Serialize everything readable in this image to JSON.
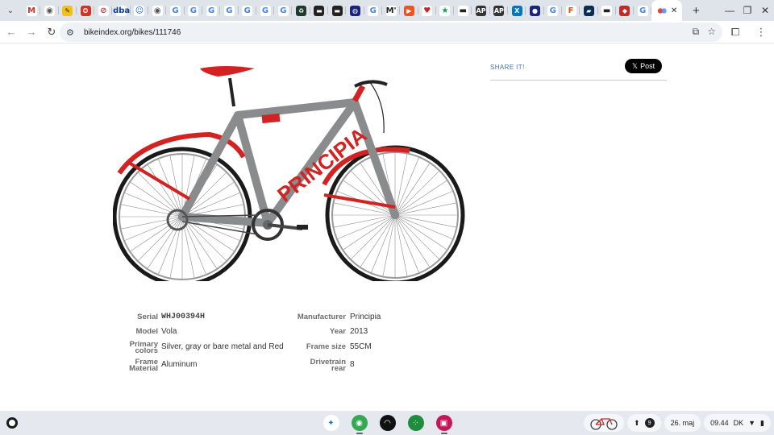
{
  "browser": {
    "tabs": [
      {
        "icon": "gmail-icon",
        "color": "#d93025",
        "glyph": "M",
        "bg": "#ffffff"
      },
      {
        "icon": "chrome-tab-icon",
        "color": "#555555",
        "glyph": "◉",
        "bg": "#ffffff"
      },
      {
        "icon": "yellow-app-icon",
        "color": "#222",
        "glyph": "✎",
        "bg": "#f4c20d"
      },
      {
        "icon": "red-circle-icon",
        "color": "#fff",
        "glyph": "✪",
        "bg": "#d93025"
      },
      {
        "icon": "block-icon",
        "color": "#d93025",
        "glyph": "⊘",
        "bg": "#ffffff"
      },
      {
        "icon": "dba-icon",
        "color": "#0b3d91",
        "glyph": "dba",
        "bg": "#ffffff"
      },
      {
        "icon": "blue-face-icon",
        "color": "#0b57d0",
        "glyph": "☺",
        "bg": "#ffffff"
      },
      {
        "icon": "globe-icon",
        "color": "#555",
        "glyph": "◉",
        "bg": "#ffffff"
      },
      {
        "icon": "google-icon",
        "color": "#4285f4",
        "glyph": "G",
        "bg": "#ffffff"
      },
      {
        "icon": "google-icon",
        "color": "#4285f4",
        "glyph": "G",
        "bg": "#ffffff"
      },
      {
        "icon": "google-icon",
        "color": "#4285f4",
        "glyph": "G",
        "bg": "#ffffff"
      },
      {
        "icon": "google-icon",
        "color": "#4285f4",
        "glyph": "G",
        "bg": "#ffffff"
      },
      {
        "icon": "google-icon",
        "color": "#4285f4",
        "glyph": "G",
        "bg": "#ffffff"
      },
      {
        "icon": "google-icon",
        "color": "#4285f4",
        "glyph": "G",
        "bg": "#ffffff"
      },
      {
        "icon": "google-icon",
        "color": "#4285f4",
        "glyph": "G",
        "bg": "#ffffff"
      },
      {
        "icon": "recycle-icon",
        "color": "#fff",
        "glyph": "♻",
        "bg": "#1e3a2a"
      },
      {
        "icon": "dark-square-icon",
        "color": "#fff",
        "glyph": "▬",
        "bg": "#222222"
      },
      {
        "icon": "dark-square-icon",
        "color": "#fff",
        "glyph": "▬",
        "bg": "#222222"
      },
      {
        "icon": "blue-globe-icon",
        "color": "#fff",
        "glyph": "◍",
        "bg": "#1a237e"
      },
      {
        "icon": "google-icon",
        "color": "#4285f4",
        "glyph": "G",
        "bg": "#ffffff"
      },
      {
        "icon": "medium-icon",
        "color": "#222",
        "glyph": "M'",
        "bg": "#ffffff"
      },
      {
        "icon": "orange-play-icon",
        "color": "#fff",
        "glyph": "▶",
        "bg": "#f4511e"
      },
      {
        "icon": "heart-icon",
        "color": "#c62828",
        "glyph": "♥",
        "bg": "#ffffff"
      },
      {
        "icon": "star-icon",
        "color": "#0f9d58",
        "glyph": "★",
        "bg": "#ffffff"
      },
      {
        "icon": "dash-icon",
        "color": "#222",
        "glyph": "▬",
        "bg": "#ffffff"
      },
      {
        "icon": "ap-icon",
        "color": "#fff",
        "glyph": "AP",
        "bg": "#333333"
      },
      {
        "icon": "ap-icon",
        "color": "#fff",
        "glyph": "AP",
        "bg": "#333333"
      },
      {
        "icon": "x-app-icon",
        "color": "#fff",
        "glyph": "X",
        "bg": "#0277bd"
      },
      {
        "icon": "pill-icon",
        "color": "#fff",
        "glyph": "●",
        "bg": "#1a237e"
      },
      {
        "icon": "google-icon",
        "color": "#4285f4",
        "glyph": "G",
        "bg": "#ffffff"
      },
      {
        "icon": "f-icon",
        "color": "#e65100",
        "glyph": "F",
        "bg": "#ffffff"
      },
      {
        "icon": "bag-icon",
        "color": "#fff",
        "glyph": "▰",
        "bg": "#0d2c54"
      },
      {
        "icon": "dash-icon",
        "color": "#222",
        "glyph": "▬",
        "bg": "#ffffff"
      },
      {
        "icon": "red-app-icon",
        "color": "#fff",
        "glyph": "◆",
        "bg": "#c62828"
      },
      {
        "icon": "google-icon",
        "color": "#4285f4",
        "glyph": "G",
        "bg": "#ffffff"
      }
    ],
    "active_tab": {
      "icon": "shield-icon",
      "close": "✕"
    },
    "new_tab": "+",
    "window_controls": {
      "minimize": "—",
      "restore": "❐",
      "close": "✕"
    },
    "url": "bikeindex.org/bikes/111746",
    "nav": {
      "back": "←",
      "forward": "→",
      "reload": "↻"
    }
  },
  "share": {
    "label": "SHARE IT!",
    "post_button": "Post",
    "post_icon": "𝕏"
  },
  "bike": {
    "brand_decal": "PRINCIPIA",
    "colors": {
      "frame": "#8a8b8d",
      "accent": "#d32222",
      "tire": "#1a1a1a"
    }
  },
  "details": [
    {
      "label": "Serial",
      "value": "WHJ00394H",
      "mono": true
    },
    {
      "label": "Manufacturer",
      "value": "Principia"
    },
    {
      "label": "Model",
      "value": "Vola"
    },
    {
      "label": "Year",
      "value": "2013"
    },
    {
      "label": "Primary colors",
      "label_lines": [
        "Primary",
        "colors"
      ],
      "value": "Silver, gray or bare metal and Red"
    },
    {
      "label": "Frame size",
      "value": "55CM"
    },
    {
      "label": "Frame Material",
      "label_lines": [
        "Frame",
        "Material"
      ],
      "value": "Aluminum"
    },
    {
      "label": "Drivetrain rear",
      "label_lines": [
        "Drivetrain",
        "rear"
      ],
      "value": "8"
    }
  ],
  "shelf": {
    "apps": [
      {
        "name": "gemini-icon",
        "glyph": "✦",
        "bg": "#ffffff",
        "fg": "#1a73e8"
      },
      {
        "name": "chrome-icon",
        "glyph": "◉",
        "bg": "#34a853",
        "fg": "#ffffff",
        "running": true
      },
      {
        "name": "podcast-icon",
        "glyph": "◠",
        "bg": "#111111",
        "fg": "#ffffff"
      },
      {
        "name": "apps-grid-icon",
        "glyph": "⁘",
        "bg": "#1e8e3e",
        "fg": "#ffffff"
      },
      {
        "name": "gallery-icon",
        "glyph": "▣",
        "bg": "#c2185b",
        "fg": "#ffffff",
        "running": true
      }
    ],
    "tray": {
      "notification_count": "9",
      "date": "26. maj",
      "time": "09.44",
      "locale": "DK"
    }
  }
}
